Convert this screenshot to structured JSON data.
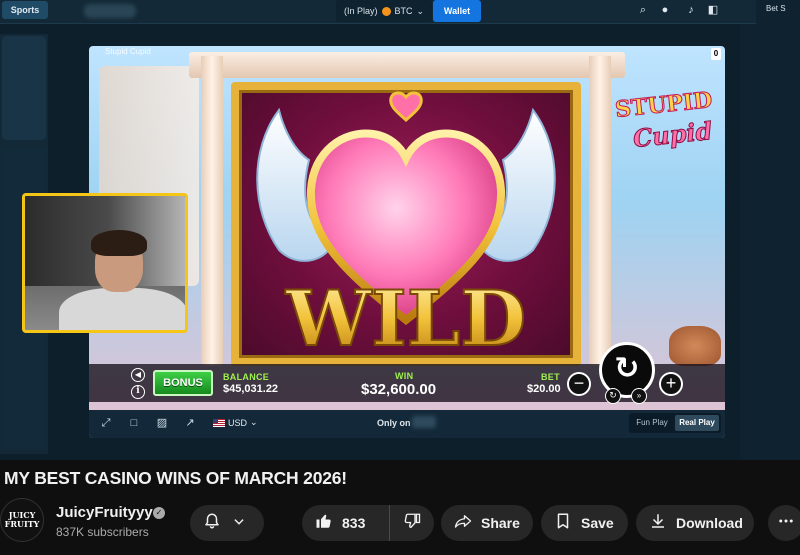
{
  "casino": {
    "sports_tab": "Sports",
    "balance_mode": "(In Play)",
    "currency_code": "BTC",
    "wallet_label": "Wallet",
    "betslip_label": "Bet S"
  },
  "game": {
    "frame_title": "Stupid Cupid",
    "close_glyph": "0",
    "logo_line1": "STUPID",
    "logo_line2": "Cupid",
    "symbol_text": "WILD",
    "bonus_label": "BONUS",
    "balance_label": "BALANCE",
    "balance_value": "$45,031.22",
    "win_label": "WIN",
    "win_value": "$32,600.00",
    "bet_label": "BET",
    "bet_value": "$20.00",
    "minus_glyph": "−",
    "plus_glyph": "+",
    "spin_glyph": "↻",
    "autoplay_glyph": "↻",
    "turbo_glyph": "»"
  },
  "controls": {
    "currency": "USD",
    "only_on": "Only on",
    "fun_play": "Fun Play",
    "real_play": "Real Play"
  },
  "video": {
    "title": "MY BEST CASINO WINS OF MARCH 2026!",
    "channel_name": "JuicyFruityyy",
    "avatar_text": "JUICY FRUITY",
    "subscribers": "837K subscribers",
    "like_count": "833",
    "share_label": "Share",
    "save_label": "Save",
    "download_label": "Download"
  },
  "icons": {
    "search": "search-icon",
    "user": "user-icon",
    "notifications": "bell-icon",
    "sidebar": "sidebar-icon",
    "like": "thumbs-up-icon",
    "dislike": "thumbs-down-icon",
    "share": "share-arrow-icon",
    "save": "bookmark-icon",
    "download": "download-icon",
    "more": "more-horizontal-icon"
  },
  "colors": {
    "wallet_blue": "#1475e1",
    "bonus_green": "#3fcf45",
    "label_green": "#9ef24e",
    "webcam_border": "#f5c518",
    "reel_gold": "#e6b23a"
  }
}
